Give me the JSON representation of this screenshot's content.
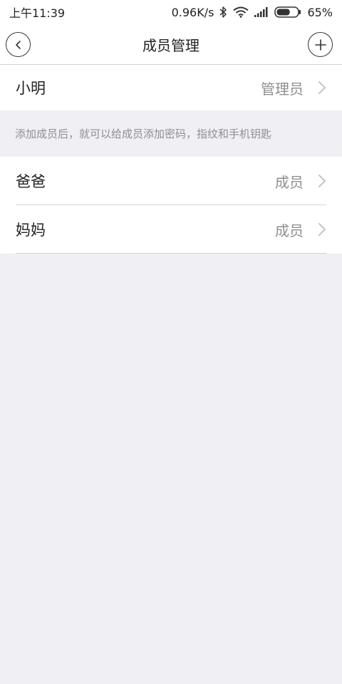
{
  "status_bar": {
    "time": "上午11:39",
    "network_speed": "0.96K/s",
    "battery_percent": "65%",
    "battery_level": 0.65,
    "icons": [
      "bluetooth-icon",
      "wifi-icon",
      "signal-icon",
      "battery-icon"
    ]
  },
  "nav": {
    "title": "成员管理",
    "back_icon": "back-icon",
    "add_icon": "add-icon"
  },
  "admin": {
    "name": "小明",
    "role": "管理员"
  },
  "hint": "添加成员后，就可以给成员添加密码，指纹和手机钥匙",
  "members": [
    {
      "name": "爸爸",
      "role": "成员"
    },
    {
      "name": "妈妈",
      "role": "成员"
    }
  ],
  "colors": {
    "background": "#efeff4",
    "surface": "#ffffff",
    "secondary_text": "#8e8e93",
    "divider": "#d4d4d8"
  }
}
